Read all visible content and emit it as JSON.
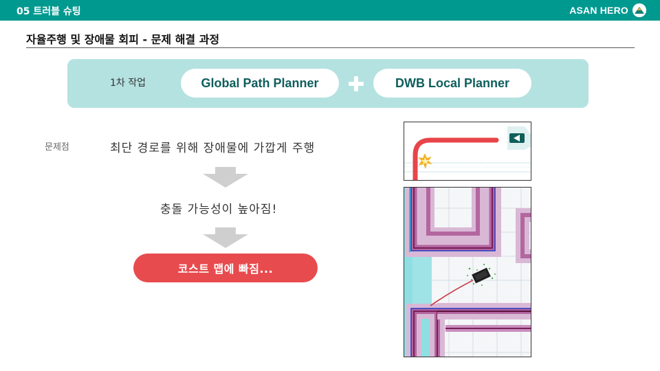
{
  "header": {
    "section": "05 트러블 슈팅",
    "logo_text": "ASAN HERO"
  },
  "title": "자율주행 및 장애물 회피 - 문제 해결 과정",
  "stage": {
    "label": "1차 작업",
    "global_planner": "Global Path Planner",
    "local_planner": "DWB Local Planner"
  },
  "problem": {
    "label": "문제점",
    "description": "최단 경로를 위해 장애물에 가깝게 주행",
    "result": "충돌 가능성이 높아짐!",
    "outcome": "코스트 맵에 빠짐..."
  },
  "colors": {
    "header_teal": "#009990",
    "panel_teal": "#b4e2e0",
    "pill_text": "#0d5e5c",
    "alert_red": "#e84b4e"
  }
}
